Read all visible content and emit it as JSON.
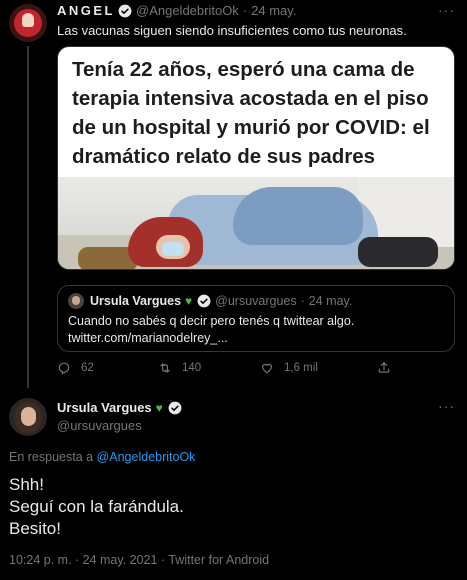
{
  "parent_tweet": {
    "author_name": "ANGEL",
    "handle": "@AngeldebritoOk",
    "separator": "·",
    "date": "24 may.",
    "more_label": "···",
    "text": "Las vacunas siguen siendo insuficientes como tus neuronas.",
    "media": {
      "headline": "Tenía 22 años, esperó una cama de terapia intensiva acostada en el piso de un hospital y murió por COVID: el dramático relato de sus padres"
    },
    "quoted_tweet": {
      "author_name": "Ursula Vargues",
      "heart": "♥",
      "handle": "@ursuvargues",
      "separator": "·",
      "date": "24 may.",
      "text_line1": "Cuando no sabés q decir pero tenés q twittear algo.",
      "text_line2": "twitter.com/marianodelrey_..."
    },
    "actions": {
      "replies": "62",
      "retweets": "140",
      "likes": "1,6 mil"
    }
  },
  "main_tweet": {
    "author_name": "Ursula Vargues",
    "heart": "♥",
    "handle": "@ursuvargues",
    "more_label": "···",
    "reply_prefix": "En respuesta a",
    "reply_mention": "@AngeldebritoOk",
    "text_lines": [
      "Shh!",
      "Seguí con la farándula.",
      "Besito!"
    ],
    "meta": "10:24 p. m. · 24 may. 2021 · Twitter for Android"
  },
  "colors": {
    "background": "#000000",
    "accent": "#1d9bf0",
    "muted": "#71767b",
    "heart": "#45b849"
  },
  "icons": [
    "verified-badge-icon",
    "reply-icon",
    "retweet-icon",
    "like-icon",
    "share-icon",
    "more-icon"
  ]
}
